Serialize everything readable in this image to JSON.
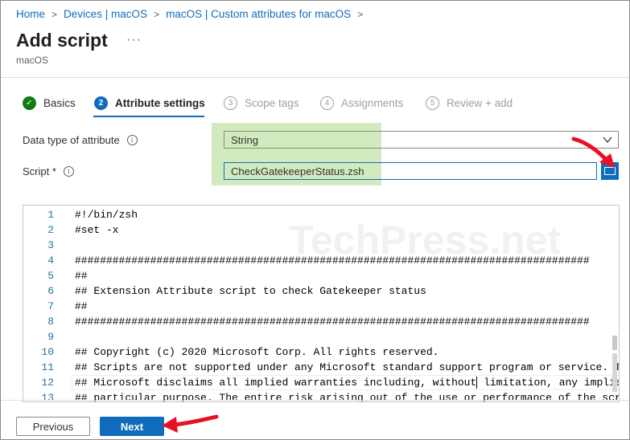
{
  "breadcrumb": [
    "Home",
    "Devices | macOS",
    "macOS | Custom attributes for macOS"
  ],
  "page": {
    "title": "Add script",
    "subtitle": "macOS",
    "more_label": "···"
  },
  "steps": [
    {
      "number": "✓",
      "label": "Basics",
      "state": "done"
    },
    {
      "number": "2",
      "label": "Attribute settings",
      "state": "active"
    },
    {
      "number": "3",
      "label": "Scope tags",
      "state": "pending"
    },
    {
      "number": "4",
      "label": "Assignments",
      "state": "pending"
    },
    {
      "number": "5",
      "label": "Review + add",
      "state": "pending"
    }
  ],
  "form": {
    "data_type_label": "Data type of attribute",
    "data_type_value": "String",
    "script_label": "Script *",
    "script_value": "CheckGatekeeperStatus.zsh",
    "info_glyph": "i"
  },
  "editor": {
    "watermark": "TechPress.net",
    "lines": [
      {
        "n": "1",
        "text": "#!/bin/zsh"
      },
      {
        "n": "2",
        "text": "#set -x"
      },
      {
        "n": "3",
        "text": ""
      },
      {
        "n": "4",
        "text": "##################################################################################"
      },
      {
        "n": "5",
        "text": "##"
      },
      {
        "n": "6",
        "text": "## Extension Attribute script to check Gatekeeper status"
      },
      {
        "n": "7",
        "text": "##"
      },
      {
        "n": "8",
        "text": "##################################################################################"
      },
      {
        "n": "9",
        "text": ""
      },
      {
        "n": "10",
        "text": "## Copyright (c) 2020 Microsoft Corp. All rights reserved."
      },
      {
        "n": "11",
        "text": "## Scripts are not supported under any Microsoft standard support program or service. Th"
      },
      {
        "n": "12",
        "text_before_caret": "## Microsoft disclaims all implied warranties including, without",
        "text_after_caret": " limitation, any implied"
      },
      {
        "n": "13",
        "text": "## particular purpose. The entire risk arising out of the use or performance of the scri"
      }
    ]
  },
  "footer": {
    "previous_label": "Previous",
    "next_label": "Next"
  },
  "colors": {
    "accent": "#0f6cbd",
    "success": "#107c10",
    "annotation": "#e81123",
    "highlight": "#c9e8b4"
  }
}
